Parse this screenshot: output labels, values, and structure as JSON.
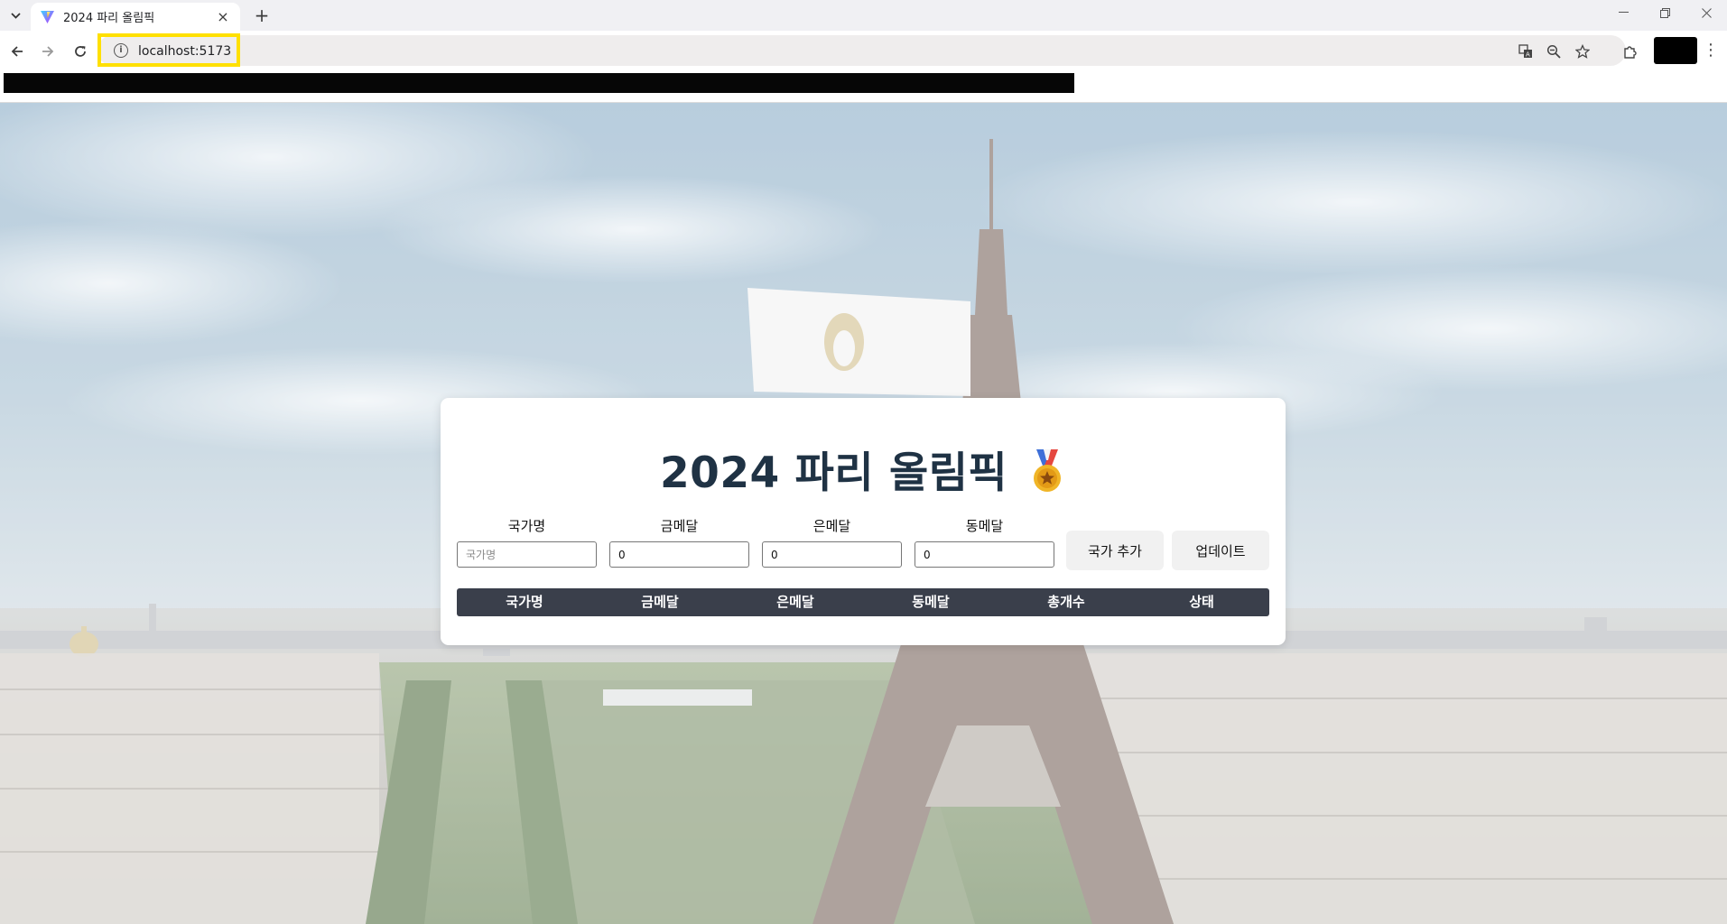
{
  "browser": {
    "tab_title": "2024 파리 올림픽",
    "url": "localhost:5173",
    "tab_list_icon": "chevron-down-icon",
    "new_tab_label": "+",
    "close_tab_label": "×"
  },
  "page": {
    "title": "2024 파리 올림픽",
    "title_emoji": "medal-icon",
    "form": {
      "fields": [
        {
          "label": "국가명",
          "value": "",
          "placeholder": "국가명"
        },
        {
          "label": "금메달",
          "value": "0",
          "placeholder": ""
        },
        {
          "label": "은메달",
          "value": "0",
          "placeholder": ""
        },
        {
          "label": "동메달",
          "value": "0",
          "placeholder": ""
        }
      ],
      "add_button": "국가 추가",
      "update_button": "업데이트"
    },
    "table": {
      "headers": [
        "국가명",
        "금메달",
        "은메달",
        "동메달",
        "총개수",
        "상태"
      ]
    },
    "colors": {
      "title": "#1f3244",
      "table_header_bg": "#3a3f4b",
      "button_bg": "#f1f1f1",
      "url_highlight": "#ffe000"
    }
  }
}
